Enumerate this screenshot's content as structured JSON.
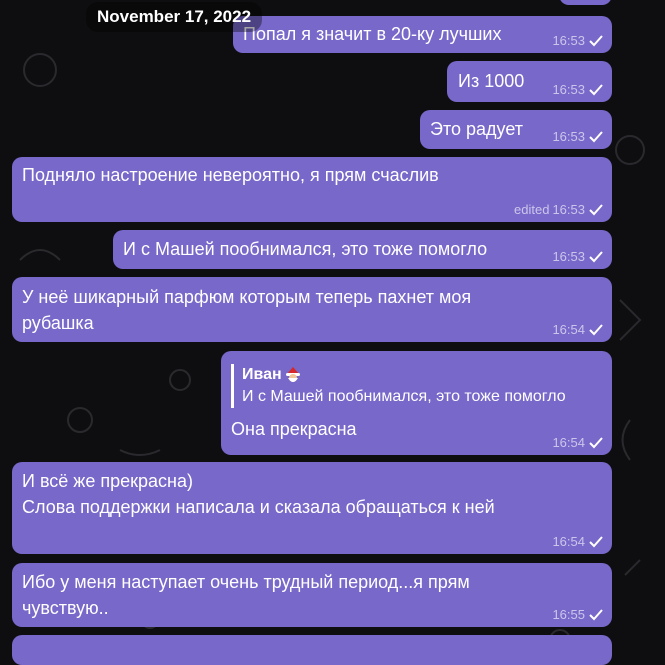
{
  "date_separator": "November 17, 2022",
  "messages": [
    {
      "id": "m1",
      "lines": [
        "Попал я значит в 20-ку лучших"
      ],
      "time": "16:53",
      "edited": ""
    },
    {
      "id": "m2",
      "lines": [
        "Из 1000"
      ],
      "time": "16:53",
      "edited": ""
    },
    {
      "id": "m3",
      "lines": [
        "Это радует"
      ],
      "time": "16:53",
      "edited": ""
    },
    {
      "id": "m4",
      "lines": [
        "Подняло настроение невероятно, я прям счаслив"
      ],
      "time": "16:53",
      "edited": "edited"
    },
    {
      "id": "m5",
      "lines": [
        "И с Машей пообнимался, это тоже помогло"
      ],
      "time": "16:53",
      "edited": ""
    },
    {
      "id": "m6",
      "lines": [
        "У неё шикарный парфюм которым теперь пахнет моя",
        "рубашка"
      ],
      "time": "16:54",
      "edited": ""
    },
    {
      "id": "m7",
      "reply": {
        "author": "Иван",
        "author_icon": "santa-emoji-icon",
        "text": "И с Машей пообнимался, это тоже помогло"
      },
      "lines": [
        "Она прекрасна"
      ],
      "time": "16:54",
      "edited": ""
    },
    {
      "id": "m8",
      "lines": [
        "И всё же прекрасна)",
        "Слова поддержки написала и сказала обращаться к ней"
      ],
      "time": "16:54",
      "edited": ""
    },
    {
      "id": "m9",
      "lines": [
        "Ибо у меня наступает очень трудный период...я прям",
        "чувствую.."
      ],
      "time": "16:55",
      "edited": ""
    }
  ],
  "colors": {
    "bubble": "#7768c9",
    "background": "#0e0e10",
    "text": "#ffffff"
  }
}
